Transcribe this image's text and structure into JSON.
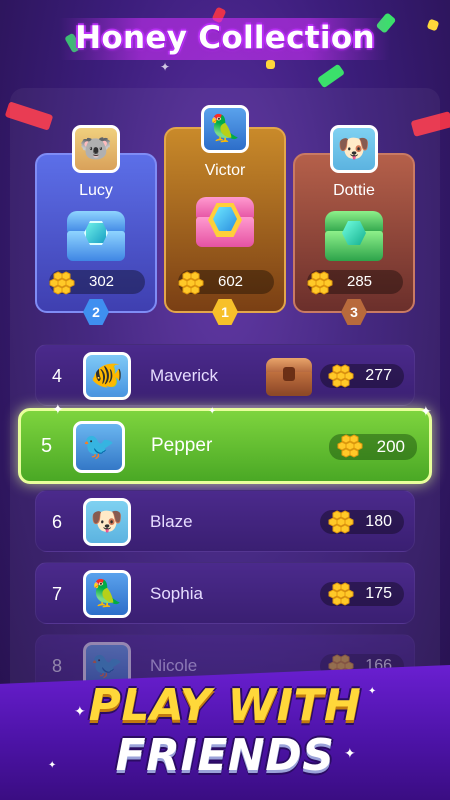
{
  "header": {
    "title": "Honey Collection"
  },
  "podium": [
    {
      "rank": "2",
      "name": "Lucy",
      "score": "302",
      "avatar_icon": "koala-avatar-icon",
      "chest": "blue-chest-icon"
    },
    {
      "rank": "1",
      "name": "Victor",
      "score": "602",
      "avatar_icon": "parrot-avatar-icon",
      "chest": "gold-chest-icon"
    },
    {
      "rank": "3",
      "name": "Dottie",
      "score": "285",
      "avatar_icon": "dog-avatar-icon",
      "chest": "green-chest-icon"
    }
  ],
  "leaderboard": [
    {
      "rank": "4",
      "name": "Maverick",
      "score": "277",
      "avatar_icon": "fish-avatar-icon",
      "reward": "wooden-chest-icon"
    },
    {
      "rank": "5",
      "name": "Pepper",
      "score": "200",
      "avatar_icon": "toucan-avatar-icon",
      "highlight": true
    },
    {
      "rank": "6",
      "name": "Blaze",
      "score": "180",
      "avatar_icon": "dog-avatar-icon"
    },
    {
      "rank": "7",
      "name": "Sophia",
      "score": "175",
      "avatar_icon": "parrot-avatar-icon"
    },
    {
      "rank": "8",
      "name": "Nicole",
      "score": "166",
      "avatar_icon": "toucan-avatar-icon"
    }
  ],
  "banner": {
    "line1": "PLAY WITH",
    "line2": "FRIENDS"
  },
  "colors": {
    "background": "#3b1d7a",
    "highlight_row": "#6cc535",
    "rank1": "#f7c02a",
    "rank2": "#3f8ff0",
    "rank3": "#b86a3c",
    "banner_yellow": "#ffd83a"
  },
  "icons": {
    "currency": "honeycomb-icon"
  }
}
